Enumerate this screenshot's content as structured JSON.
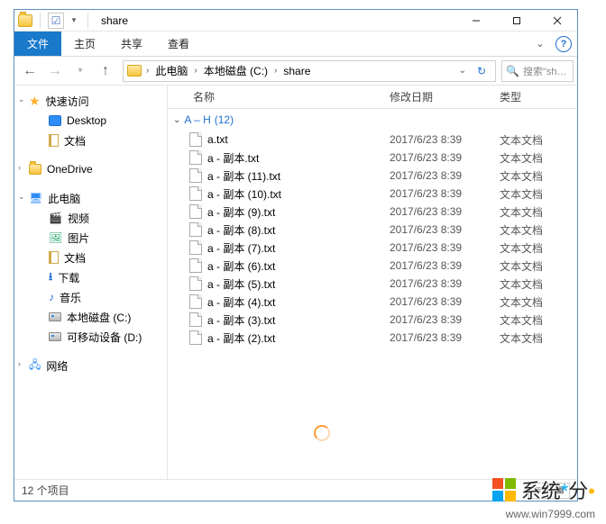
{
  "window_title": "share",
  "ribbon": {
    "file": "文件",
    "tabs": [
      "主页",
      "共享",
      "查看"
    ]
  },
  "nav": {
    "breadcrumbs": [
      "此电脑",
      "本地磁盘 (C:)",
      "share"
    ],
    "search_placeholder": "搜索\"sha..."
  },
  "columns": {
    "name": "名称",
    "date": "修改日期",
    "type": "类型"
  },
  "tree": {
    "quick_access": "快速访问",
    "desktop": "Desktop",
    "documents": "文档",
    "onedrive": "OneDrive",
    "this_pc": "此电脑",
    "videos": "视频",
    "pictures": "图片",
    "docs2": "文档",
    "downloads": "下载",
    "music": "音乐",
    "local_c": "本地磁盘 (C:)",
    "removable_d": "可移动设备 (D:)",
    "network": "网络"
  },
  "group": {
    "name": "A – H",
    "count": "(12)"
  },
  "files": [
    {
      "name": "a.txt",
      "date": "2017/6/23 8:39",
      "type": "文本文档"
    },
    {
      "name": "a - 副本.txt",
      "date": "2017/6/23 8:39",
      "type": "文本文档"
    },
    {
      "name": "a - 副本 (11).txt",
      "date": "2017/6/23 8:39",
      "type": "文本文档"
    },
    {
      "name": "a - 副本 (10).txt",
      "date": "2017/6/23 8:39",
      "type": "文本文档"
    },
    {
      "name": "a - 副本 (9).txt",
      "date": "2017/6/23 8:39",
      "type": "文本文档"
    },
    {
      "name": "a - 副本 (8).txt",
      "date": "2017/6/23 8:39",
      "type": "文本文档"
    },
    {
      "name": "a - 副本 (7).txt",
      "date": "2017/6/23 8:39",
      "type": "文本文档"
    },
    {
      "name": "a - 副本 (6).txt",
      "date": "2017/6/23 8:39",
      "type": "文本文档"
    },
    {
      "name": "a - 副本 (5).txt",
      "date": "2017/6/23 8:39",
      "type": "文本文档"
    },
    {
      "name": "a - 副本 (4).txt",
      "date": "2017/6/23 8:39",
      "type": "文本文档"
    },
    {
      "name": "a - 副本 (3).txt",
      "date": "2017/6/23 8:39",
      "type": "文本文档"
    },
    {
      "name": "a - 副本 (2).txt",
      "date": "2017/6/23 8:39",
      "type": "文本文档"
    }
  ],
  "status": "12 个项目",
  "watermark": {
    "text_pre": "系统",
    "text_post": "分",
    "site": "www.win7999.com"
  }
}
